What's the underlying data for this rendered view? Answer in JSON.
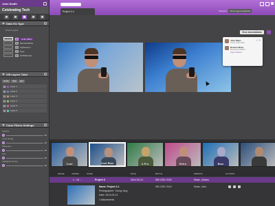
{
  "user": {
    "name": "John Smith"
  },
  "workspace": {
    "title": "Celebrating Tech"
  },
  "sidebar": {
    "layout_panel": {
      "title": "Data Vis Type",
      "sub_label": "Preset Layout",
      "options": [
        "Color Pikes",
        "Manual Bobbs",
        "Lightscreen",
        "Type",
        "Hil Bladi bed"
      ]
    },
    "layers_panel": {
      "title": "VIS Layers Total",
      "tabs": [
        "SHOW",
        "HIDE",
        "EDIT"
      ],
      "layers": [
        "Layer 1",
        "Layer 2",
        "Layer 3",
        "Layer 4",
        "Layer 5",
        "Layer 6"
      ],
      "colors": [
        "#9b59c9",
        "#6b8fd1",
        "#d1a06b",
        "#8ed16b",
        "#d16b9b",
        "#6bd1c9"
      ]
    },
    "filters_panel": {
      "title": "Color Filters Settings",
      "filters": [
        {
          "label": "Opacity",
          "value": "50"
        },
        {
          "label": "Color Range",
          "value": "40"
        },
        {
          "label": "Saturation",
          "value": "30"
        },
        {
          "label": "Hue",
          "value": "60"
        },
        {
          "label": "Highlights Range",
          "value": "20"
        }
      ]
    }
  },
  "main": {
    "project_tab": "Project 2-1",
    "layers_selected_label": "Selection",
    "layers_selected_value": "None Layers Selected",
    "view_annotations": "View Annotations",
    "annotations": [
      {
        "name": "John Maps",
        "message": "Lorem ipsum dolor"
      },
      {
        "name": "Deanna Maps",
        "message": "Recently annotated",
        "reply": "Layers deleted"
      }
    ]
  },
  "filmstrip": {
    "items": [
      {
        "label": "Cool",
        "bg": "#2a5f9e",
        "skin": "#c18f78",
        "shirt": "#4a4a4a"
      },
      {
        "label": "Cool Blue",
        "bg": "#1e4f8a",
        "skin": "#b7917c",
        "shirt": "#3b4a5a"
      },
      {
        "label": "X-Pro",
        "bg": "#2f7a45",
        "skin": "#c6a26b",
        "shirt": "#4a5a3a"
      },
      {
        "label": "Retro",
        "bg": "#c04b8c",
        "skin": "#c18f78",
        "shirt": "#6a4a5a"
      },
      {
        "label": "Blue",
        "bg": "#1d6fb8",
        "skin": "#a8a8c8",
        "shirt": "#3a3a6a"
      },
      {
        "label": "",
        "bg": "#2d4f7a",
        "skin": "#b08a70",
        "shirt": "#3a3a3a"
      }
    ]
  },
  "table": {
    "headers": [
      "IMAGE",
      "ORDER",
      "NAME",
      "DATE",
      "BATCH",
      "PERSON",
      "ACTIONS"
    ],
    "row": {
      "order": "1 - 16 ...",
      "name": "Project 3",
      "date": "2014-03-14",
      "batch": "IND 2201 2100",
      "person": "Klaas, Johann"
    },
    "detail": {
      "name": "Name: Project 2-1",
      "photographer": "Photographer: Young Jung",
      "date": "Date: 2014-03-14",
      "attachments": "2 Attachments",
      "batch": "IND 2201 2100",
      "person": "Klaas, John"
    }
  }
}
